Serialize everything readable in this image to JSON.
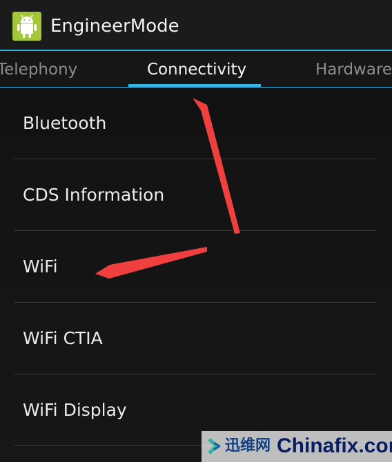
{
  "app": {
    "title": "EngineerMode",
    "icon": "android-icon"
  },
  "tabs": [
    {
      "label": "Telephony",
      "selected": false
    },
    {
      "label": "Connectivity",
      "selected": true
    },
    {
      "label": "Hardware",
      "selected": false
    }
  ],
  "menu_items": [
    {
      "label": "Bluetooth"
    },
    {
      "label": "CDS Information"
    },
    {
      "label": "WiFi"
    },
    {
      "label": "WiFi CTIA"
    },
    {
      "label": "WiFi Display"
    }
  ],
  "watermark": {
    "logo_text": "迅维网",
    "site": "Chinafix.com"
  },
  "colors": {
    "accent": "#34b5e5",
    "android_green": "#a4c639",
    "annotation_arrow": "#ef3f3f",
    "background": "#101010"
  }
}
